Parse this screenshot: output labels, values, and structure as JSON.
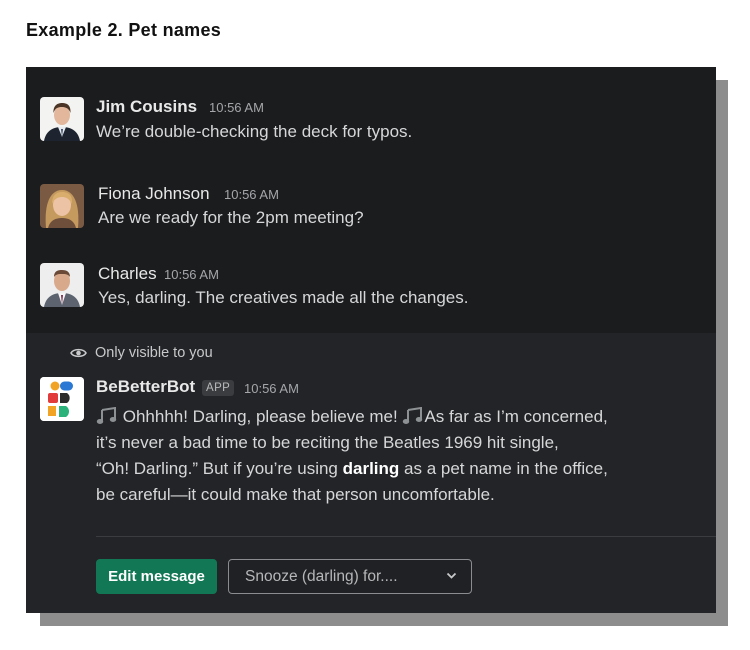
{
  "page": {
    "heading": "Example 2. Pet names"
  },
  "messages": [
    {
      "author": "Jim Cousins",
      "time": "10:56 AM",
      "text": "We’re double-checking the deck for typos."
    },
    {
      "author": "Fiona Johnson",
      "time": "10:56 AM",
      "text": "Are we ready for the 2pm meeting?"
    },
    {
      "author": "Charles",
      "time": "10:56 AM",
      "text": "Yes, darling. The creatives made all the changes."
    }
  ],
  "bot": {
    "visibility_label": "Only visible to you",
    "name": "BeBetterBot",
    "badge": "APP",
    "time": "10:56 AM",
    "line1_a": "Ohhhhh! Darling, please believe me!",
    "line1_b": "As far as I’m concerned,",
    "line2": "it’s never a bad time to be reciting the Beatles 1969 hit single,",
    "line3_a": "“Oh! Darling.” But if you’re using",
    "line3_bold": "darling",
    "line3_b": "as a pet name in the office,",
    "line4": "be careful—it could make that person uncomfortable.",
    "icon": "musical-notes-icon"
  },
  "actions": {
    "edit_label": "Edit message",
    "snooze_value": "Snooze (darling) for....",
    "snooze_icon": "chevron-down-icon"
  },
  "colors": {
    "panel_bg": "#1b1c1e",
    "bot_bg": "#222427",
    "edit_button": "#127754",
    "shadow": "#8d8d8d"
  }
}
